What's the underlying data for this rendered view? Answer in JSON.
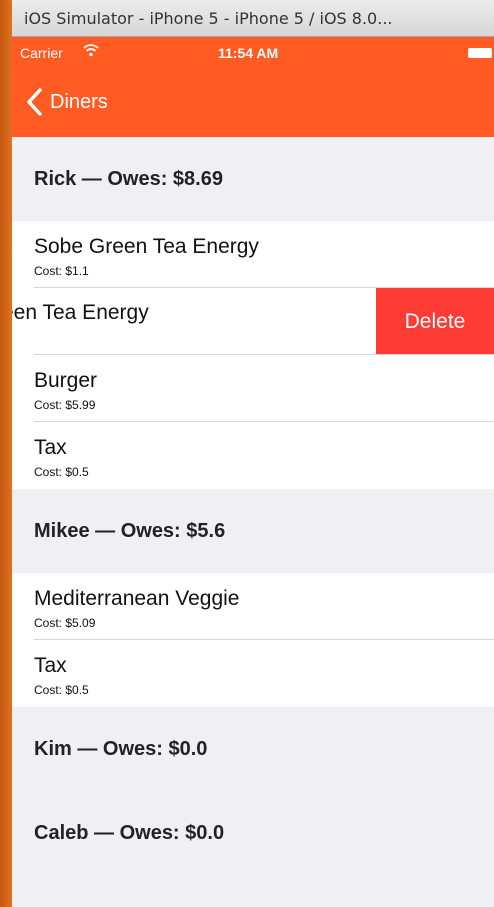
{
  "window": {
    "title": "iOS Simulator - iPhone 5 - iPhone 5 / iOS 8.0..."
  },
  "status": {
    "carrier": "Carrier",
    "time": "11:54 AM"
  },
  "nav": {
    "back_label": "Diners"
  },
  "diners": [
    {
      "header": "Rick — Owes: $8.69",
      "items": [
        {
          "name": "Sobe Green Tea Energy",
          "cost": "Cost: $1.1"
        },
        {
          "name": "een Tea Energy",
          "cost": "",
          "swiped": true,
          "action": "Delete"
        },
        {
          "name": "Burger",
          "cost": "Cost: $5.99"
        },
        {
          "name": "Tax",
          "cost": "Cost: $0.5"
        }
      ]
    },
    {
      "header": "Mikee — Owes: $5.6",
      "items": [
        {
          "name": "Mediterranean Veggie",
          "cost": "Cost: $5.09"
        },
        {
          "name": "Tax",
          "cost": "Cost: $0.5"
        }
      ]
    },
    {
      "header": "Kim — Owes: $0.0",
      "items": []
    },
    {
      "header": "Caleb — Owes: $0.0",
      "items": []
    }
  ],
  "colors": {
    "accent": "#ff5b22",
    "delete": "#fe3a35",
    "background": "#efeff4"
  }
}
